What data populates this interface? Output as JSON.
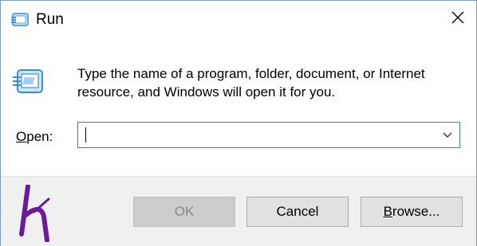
{
  "window": {
    "title": "Run",
    "icons": {
      "title_icon": "run-icon",
      "close": "close-icon",
      "big_icon": "run-icon",
      "logo": "watermark-logo"
    }
  },
  "content": {
    "description": "Type the name of a program, folder, document, or Internet resource, and Windows will open it for you.",
    "open_label_prefix": "",
    "open_label_underlined": "O",
    "open_label_rest": "pen:",
    "open_value": "",
    "dropdown_icon": "chevron-down-icon"
  },
  "buttons": {
    "ok_label": "OK",
    "ok_enabled": false,
    "cancel_label": "Cancel",
    "browse_underlined": "B",
    "browse_rest": "rowse..."
  },
  "colors": {
    "border_accent": "#3c7fb1",
    "footer_bg": "#f0f0f0",
    "logo_purple": "#6a1b9a"
  }
}
